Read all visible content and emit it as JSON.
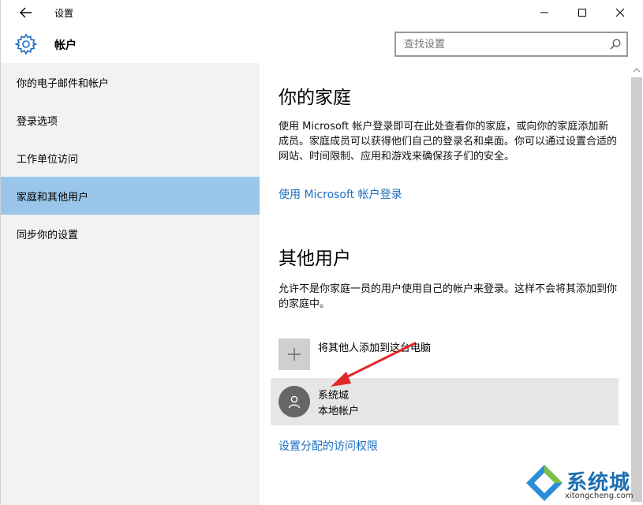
{
  "titlebar": {
    "title": "设置",
    "minimize": "—",
    "maximize": "☐",
    "close": "✕"
  },
  "header": {
    "title": "帐户",
    "search_placeholder": "查找设置"
  },
  "sidebar": {
    "items": [
      {
        "label": "你的电子邮件和帐户"
      },
      {
        "label": "登录选项"
      },
      {
        "label": "工作单位访问"
      },
      {
        "label": "家庭和其他用户",
        "active": true
      },
      {
        "label": "同步你的设置"
      }
    ]
  },
  "main": {
    "family": {
      "heading": "你的家庭",
      "desc": "使用 Microsoft 帐户登录即可在此处查看你的家庭，或向你的家庭添加新成员。家庭成员可以获得他们自己的登录名和桌面。你可以通过设置合适的网站、时间限制、应用和游戏来确保孩子们的安全。",
      "link": "使用 Microsoft 帐户登录"
    },
    "others": {
      "heading": "其他用户",
      "desc": "允许不是你家庭一员的用户使用自己的帐户来登录。这样不会将其添加到你的家庭中。",
      "add_label": "将其他人添加到这台电脑",
      "user": {
        "name": "系统城",
        "type": "本地帐户"
      },
      "link": "设置分配的访问权限"
    }
  },
  "watermark": {
    "text": "系统城",
    "url": "xitongcheng.com"
  },
  "colors": {
    "accent": "#1c6fbf",
    "active_nav": "#99c6ea",
    "sidebar_bg": "#f2f2f2",
    "annotation_arrow": "#e02a2a"
  }
}
